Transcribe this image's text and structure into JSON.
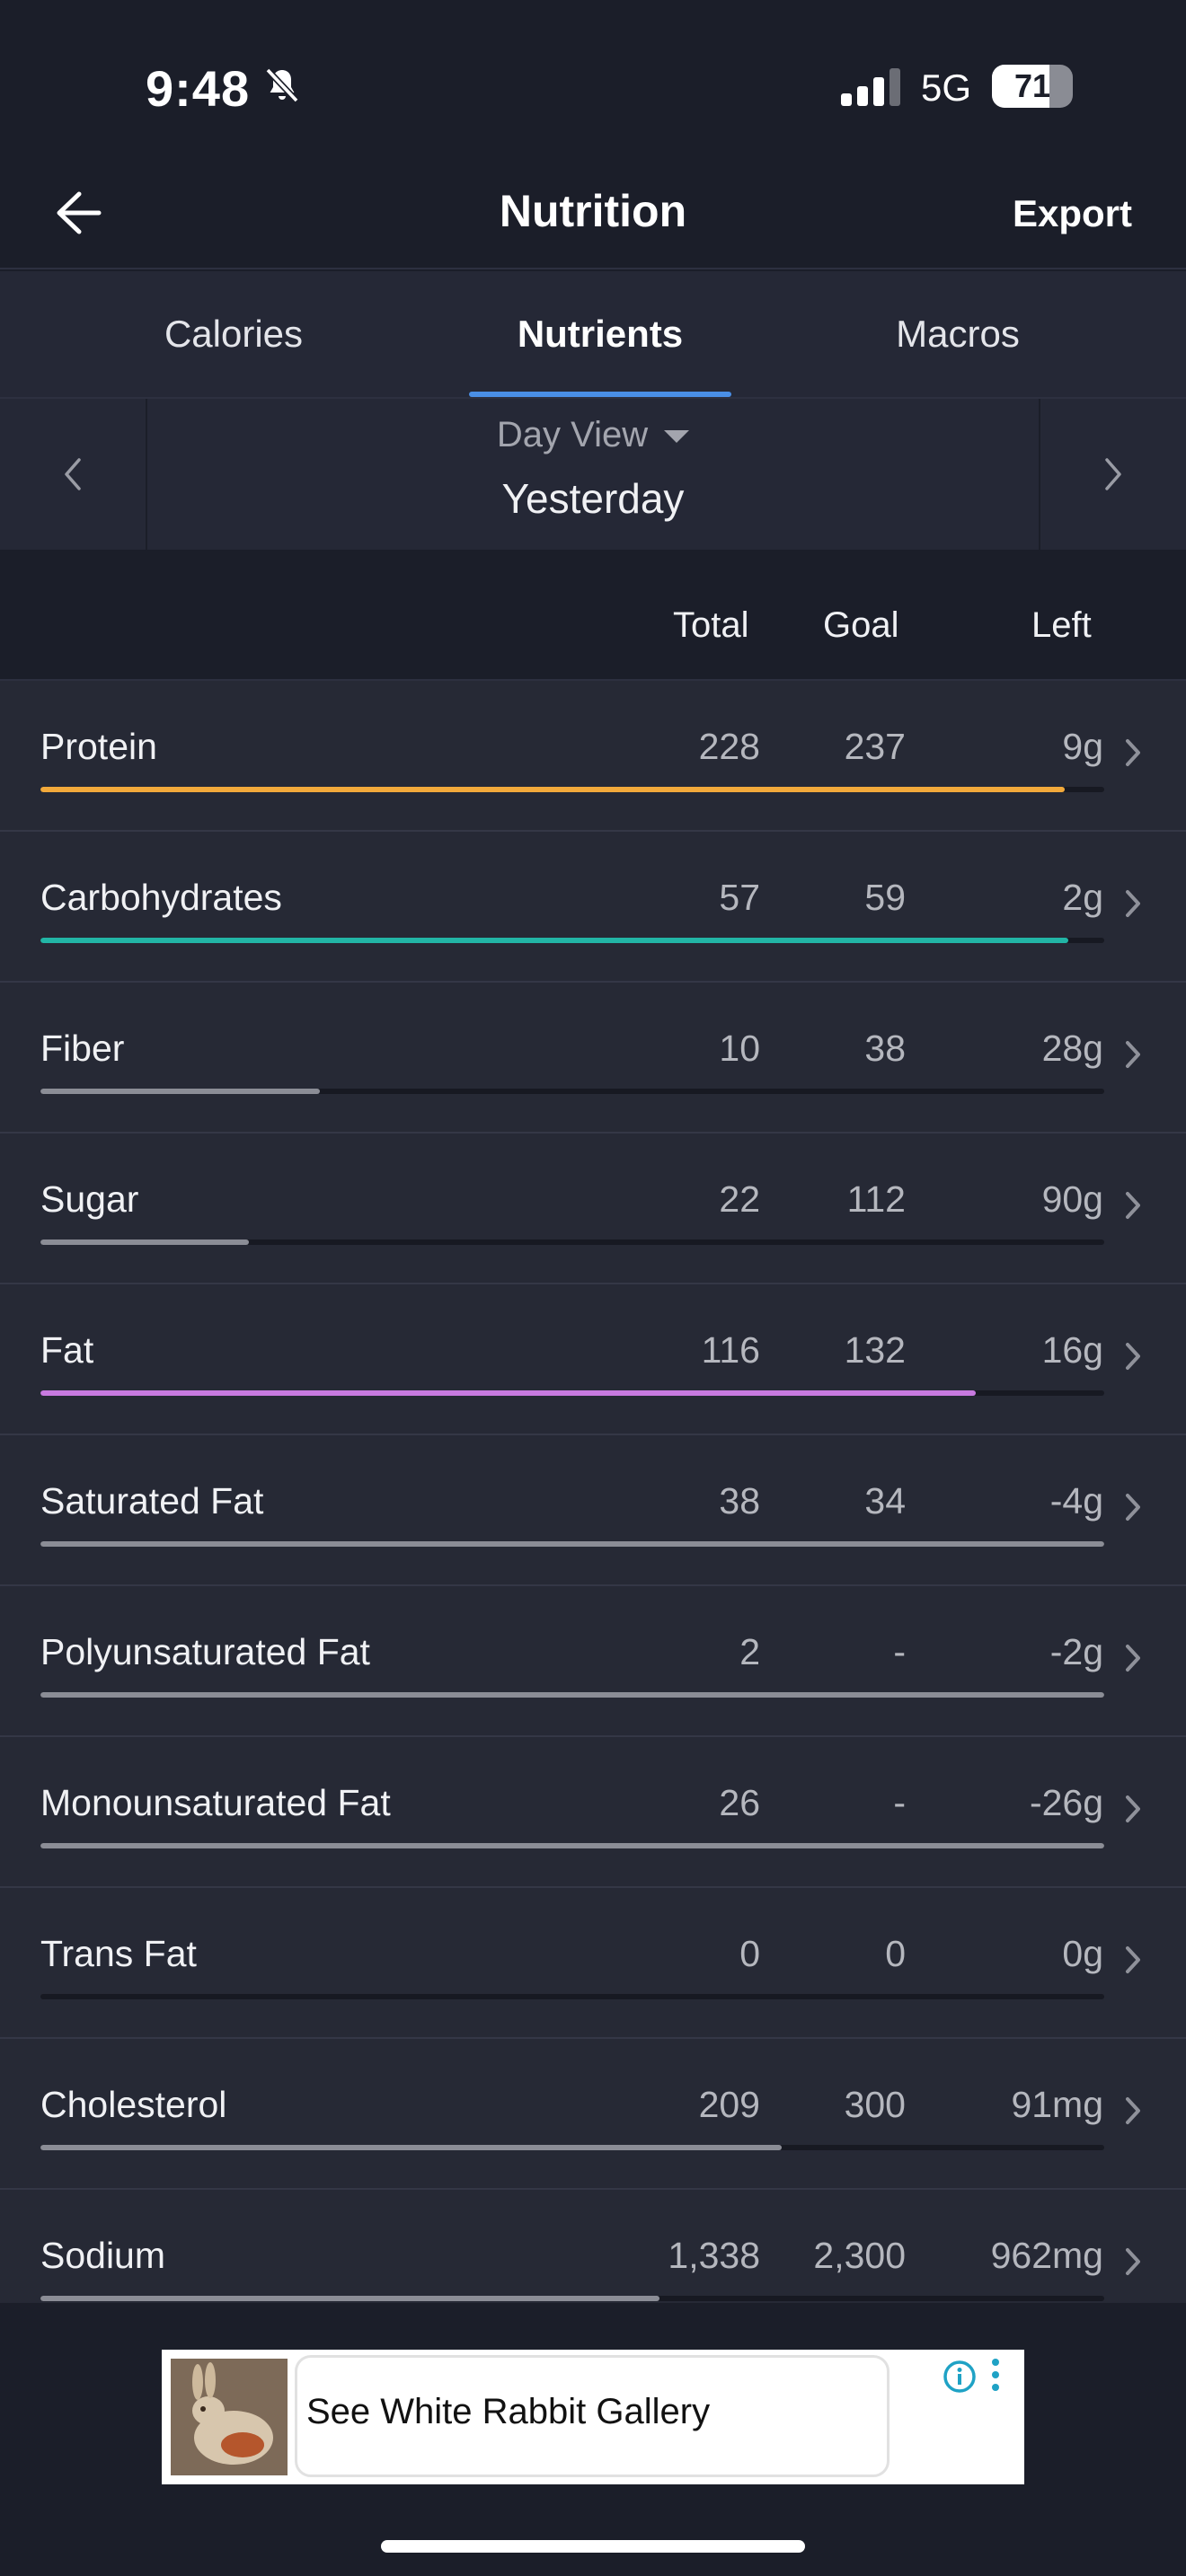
{
  "status_bar": {
    "time": "9:48",
    "network": "5G",
    "battery": "71",
    "battery_level": 0.71
  },
  "nav": {
    "title": "Nutrition",
    "export_label": "Export"
  },
  "tabs": [
    {
      "label": "Calories"
    },
    {
      "label": "Nutrients"
    },
    {
      "label": "Macros"
    }
  ],
  "date_nav": {
    "view_label": "Day View",
    "date_label": "Yesterday"
  },
  "columns": {
    "total": "Total",
    "goal": "Goal",
    "left": "Left"
  },
  "nutrients": [
    {
      "name": "Protein",
      "total": "228",
      "goal": "237",
      "left": "9g",
      "progress": 0.963,
      "color": "#f2a93b"
    },
    {
      "name": "Carbohydrates",
      "total": "57",
      "goal": "59",
      "left": "2g",
      "progress": 0.966,
      "color": "#22b5a6"
    },
    {
      "name": "Fiber",
      "total": "10",
      "goal": "38",
      "left": "28g",
      "progress": 0.263,
      "color": "#8b8d96"
    },
    {
      "name": "Sugar",
      "total": "22",
      "goal": "112",
      "left": "90g",
      "progress": 0.196,
      "color": "#8b8d96"
    },
    {
      "name": "Fat",
      "total": "116",
      "goal": "132",
      "left": "16g",
      "progress": 0.879,
      "color": "#c87ae0"
    },
    {
      "name": "Saturated Fat",
      "total": "38",
      "goal": "34",
      "left": "-4g",
      "progress": 1.0,
      "color": "#8b8d96"
    },
    {
      "name": "Polyunsaturated Fat",
      "total": "2",
      "goal": "-",
      "left": "-2g",
      "progress": 1.0,
      "color": "#8b8d96"
    },
    {
      "name": "Monounsaturated Fat",
      "total": "26",
      "goal": "-",
      "left": "-26g",
      "progress": 1.0,
      "color": "#8b8d96"
    },
    {
      "name": "Trans Fat",
      "total": "0",
      "goal": "0",
      "left": "0g",
      "progress": 0.0,
      "color": "#8b8d96"
    },
    {
      "name": "Cholesterol",
      "total": "209",
      "goal": "300",
      "left": "91mg",
      "progress": 0.697,
      "color": "#8b8d96"
    },
    {
      "name": "Sodium",
      "total": "1,338",
      "goal": "2,300",
      "left": "962mg",
      "progress": 0.582,
      "color": "#8b8d96"
    }
  ],
  "ad": {
    "text": "See White Rabbit Gallery"
  },
  "colors": {
    "accent": "#4a8fe6",
    "background": "#1b1e29",
    "panel": "#252836",
    "ad_icon": "#1fa2c5"
  }
}
